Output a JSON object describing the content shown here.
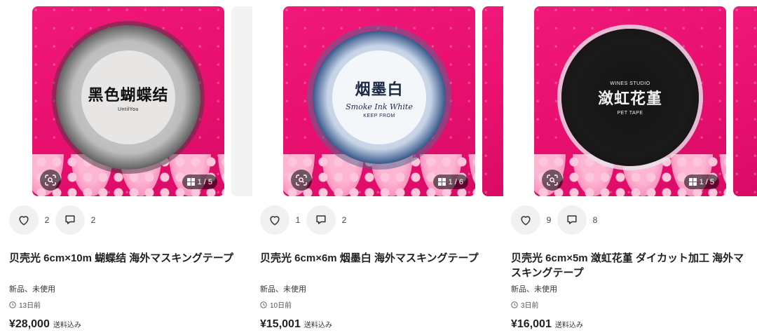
{
  "listings": [
    {
      "image": {
        "tape_title": "黑色蝴蝶结",
        "tape_sub": "",
        "tape_small": "UntilYou",
        "count": "1 / 5"
      },
      "likes": "2",
      "comments": "2",
      "title": "贝壳光 6cm×10m 蝴蝶结 海外マスキングテープ",
      "condition": "新品、未使用",
      "posted": "13日前",
      "price": "¥28,000",
      "price_note": "送料込み"
    },
    {
      "image": {
        "tape_title": "烟墨白",
        "tape_sub": "Smoke Ink White",
        "tape_small": "KEEP FROM",
        "count": "1 / 6"
      },
      "likes": "1",
      "comments": "2",
      "title": "贝壳光 6cm×6m 烟墨白 海外マスキングテープ",
      "condition": "新品、未使用",
      "posted": "10日前",
      "price": "¥15,001",
      "price_note": "送料込み"
    },
    {
      "image": {
        "tape_title": "潋虹花堇",
        "tape_sub": "WINES STUDIO",
        "tape_small": "PET TAPE",
        "count": "1 / 5"
      },
      "likes": "9",
      "comments": "8",
      "title": "贝壳光 6cm×5m 潋虹花堇 ダイカット加工 海外マスキングテープ",
      "condition": "新品、未使用",
      "posted": "3日前",
      "price": "¥16,001",
      "price_note": "送料込み"
    }
  ]
}
